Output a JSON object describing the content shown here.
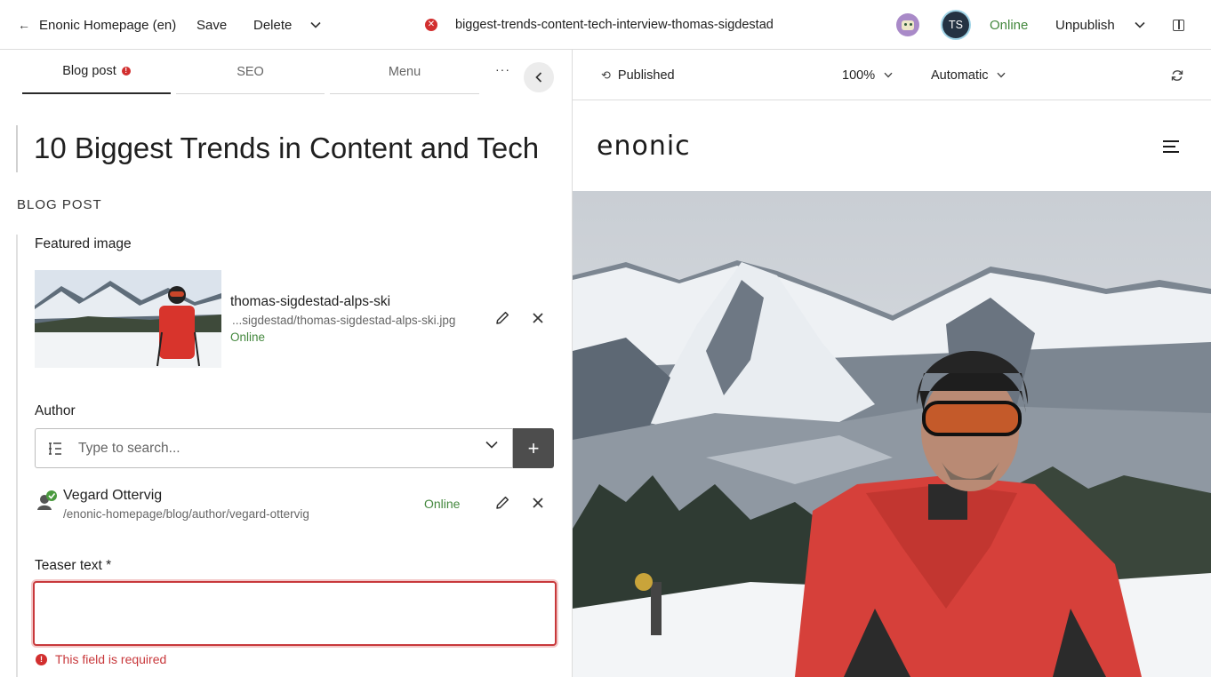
{
  "toolbar": {
    "back_label": "Enonic Homepage (en)",
    "save_label": "Save",
    "delete_label": "Delete",
    "content_path": "biggest-trends-content-tech-interview-thomas-sigdestad",
    "user_initials": "TS",
    "status": "Online",
    "unpublish_label": "Unpublish"
  },
  "tabs": [
    {
      "label": "Blog post",
      "active": true,
      "has_error": true
    },
    {
      "label": "SEO",
      "active": false
    },
    {
      "label": "Menu",
      "active": false
    }
  ],
  "more_label": "···",
  "form": {
    "title": "10 Biggest Trends in Content and Tech",
    "section_heading": "BLOG POST",
    "featured_image": {
      "label": "Featured image",
      "name": "thomas-sigdestad-alps-ski",
      "path": "...sigdestad/thomas-sigdestad-alps-ski.jpg",
      "status": "Online"
    },
    "author": {
      "label": "Author",
      "search_placeholder": "Type to search...",
      "selected": {
        "name": "Vegard Ottervig",
        "path": "/enonic-homepage/blog/author/vegard-ottervig",
        "status": "Online"
      }
    },
    "teaser": {
      "label": "Teaser text *",
      "value": "",
      "error": "This field is required"
    }
  },
  "preview": {
    "status": "Published",
    "zoom": "100%",
    "mode": "Automatic",
    "site_logo": "enonic"
  },
  "colors": {
    "online": "#44883e",
    "error": "#c8383b",
    "accent_dark": "#4d4d4d"
  }
}
